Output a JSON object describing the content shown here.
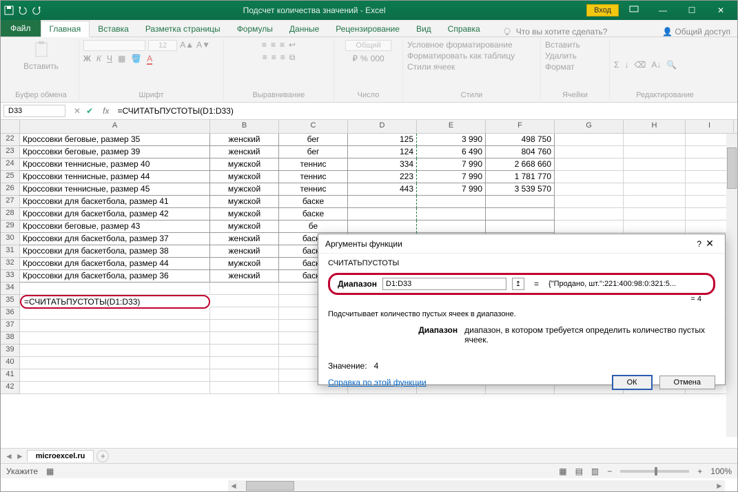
{
  "title": "Подсчет количества значений  -  Excel",
  "titlebar": {
    "login": "Вход"
  },
  "menu": {
    "file": "Файл",
    "home": "Главная",
    "insert": "Вставка",
    "layout": "Разметка страницы",
    "formulas": "Формулы",
    "data": "Данные",
    "review": "Рецензирование",
    "view": "Вид",
    "help": "Справка",
    "tellme": "Что вы хотите сделать?",
    "share": "Общий доступ"
  },
  "ribbon": {
    "clipboard": "Буфер обмена",
    "paste": "Вставить",
    "font": "Шрифт",
    "fontsize": "12",
    "align": "Выравнивание",
    "number": "Число",
    "numfmt": "Общий",
    "styles": "Стили",
    "style1": "Условное форматирование",
    "style2": "Форматировать как таблицу",
    "style3": "Стили ячеек",
    "cells": "Ячейки",
    "cellins": "Вставить",
    "celldel": "Удалить",
    "cellfmt": "Формат",
    "editing": "Редактирование",
    "bold": "Ж",
    "italic": "К",
    "underline": "Ч"
  },
  "namebox": "D33",
  "formula": "=СЧИТАТЬПУСТОТЫ(D1:D33)",
  "rows": [
    {
      "n": 22,
      "a": "Кроссовки беговые, размер 35",
      "b": "женский",
      "c": "бег",
      "d": "125",
      "e": "3 990",
      "f": "498 750"
    },
    {
      "n": 23,
      "a": "Кроссовки беговые, размер 39",
      "b": "женский",
      "c": "бег",
      "d": "124",
      "e": "6 490",
      "f": "804 760"
    },
    {
      "n": 24,
      "a": "Кроссовки теннисные, размер 40",
      "b": "мужской",
      "c": "теннис",
      "d": "334",
      "e": "7 990",
      "f": "2 668 660"
    },
    {
      "n": 25,
      "a": "Кроссовки теннисные, размер 44",
      "b": "мужской",
      "c": "теннис",
      "d": "223",
      "e": "7 990",
      "f": "1 781 770"
    },
    {
      "n": 26,
      "a": "Кроссовки теннисные, размер 45",
      "b": "мужской",
      "c": "теннис",
      "d": "443",
      "e": "7 990",
      "f": "3 539 570"
    },
    {
      "n": 27,
      "a": "Кроссовки для баскетбола, размер 41",
      "b": "мужской",
      "c": "баске",
      "d": "",
      "e": "",
      "f": ""
    },
    {
      "n": 28,
      "a": "Кроссовки для баскетбола, размер 42",
      "b": "мужской",
      "c": "баске",
      "d": "",
      "e": "",
      "f": ""
    },
    {
      "n": 29,
      "a": "Кроссовки беговые, размер 43",
      "b": "мужской",
      "c": "бе",
      "d": "",
      "e": "",
      "f": ""
    },
    {
      "n": 30,
      "a": "Кроссовки для баскетбола, размер 37",
      "b": "женский",
      "c": "баске",
      "d": "",
      "e": "",
      "f": ""
    },
    {
      "n": 31,
      "a": "Кроссовки для баскетбола, размер 38",
      "b": "женский",
      "c": "баске",
      "d": "",
      "e": "",
      "f": ""
    },
    {
      "n": 32,
      "a": "Кроссовки для баскетбола, размер 44",
      "b": "мужской",
      "c": "баске",
      "d": "",
      "e": "",
      "f": ""
    },
    {
      "n": 33,
      "a": "Кроссовки для баскетбола, размер 36",
      "b": "женский",
      "c": "баске",
      "d": "",
      "e": "",
      "f": ""
    }
  ],
  "cell35": "=СЧИТАТЬПУСТОТЫ(D1:D33)",
  "dialog": {
    "title": "Аргументы функции",
    "func": "СЧИТАТЬПУСТОТЫ",
    "arg_label": "Диапазон",
    "arg_value": "D1:D33",
    "arg_preview": "{\"Продано, шт.\":221:400:98:0:321:5...",
    "result_eq": "=  4",
    "desc": "Подсчитывает количество пустых ячеек в диапазоне.",
    "arg_name": "Диапазон",
    "arg_desc": "диапазон, в котором требуется определить количество пустых ячеек.",
    "value_label": "Значение:",
    "value": "4",
    "help": "Справка по этой функции",
    "ok": "ОК",
    "cancel": "Отмена"
  },
  "sheet": {
    "name": "microexcel.ru"
  },
  "status": {
    "mode": "Укажите",
    "zoom": "100%"
  },
  "cols": [
    "A",
    "B",
    "C",
    "D",
    "E",
    "F",
    "G",
    "H",
    "I"
  ]
}
